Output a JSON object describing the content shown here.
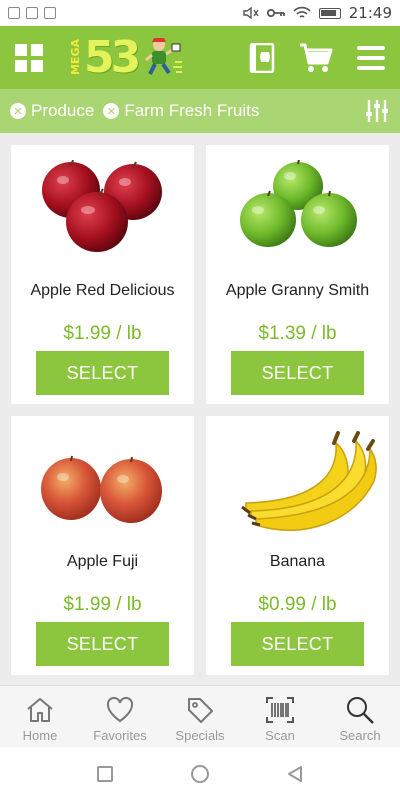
{
  "status_bar": {
    "time": "21:49"
  },
  "header": {
    "logo_mega": "MEGA",
    "logo_number": "53",
    "accent_color": "#8cc63f"
  },
  "filters": [
    {
      "label": "Produce"
    },
    {
      "label": "Farm Fresh Fruits"
    }
  ],
  "products": [
    {
      "name": "Apple Red Delicious",
      "price": "$1.99 / lb",
      "button": "SELECT",
      "image": "red-apples-image"
    },
    {
      "name": "Apple Granny Smith",
      "price": "$1.39 / lb",
      "button": "SELECT",
      "image": "green-apples-image"
    },
    {
      "name": "Apple Fuji",
      "price": "$1.99 / lb",
      "button": "SELECT",
      "image": "fuji-apples-image"
    },
    {
      "name": "Banana",
      "price": "$0.99 / lb",
      "button": "SELECT",
      "image": "bananas-image"
    }
  ],
  "bottom_nav": [
    {
      "label": "Home",
      "icon": "home-icon"
    },
    {
      "label": "Favorites",
      "icon": "heart-icon"
    },
    {
      "label": "Specials",
      "icon": "tag-icon"
    },
    {
      "label": "Scan",
      "icon": "barcode-icon"
    },
    {
      "label": "Search",
      "icon": "search-icon"
    }
  ]
}
